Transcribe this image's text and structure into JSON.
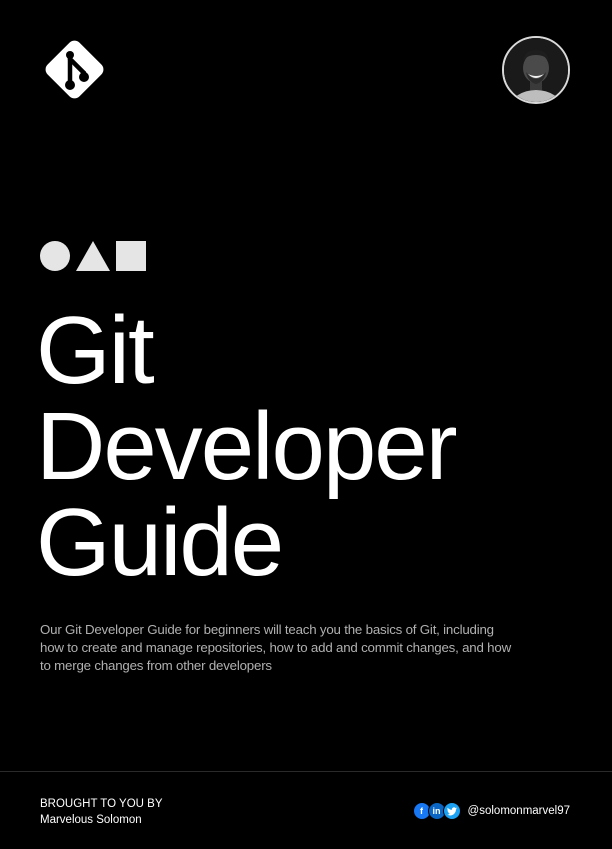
{
  "header": {
    "logo_icon": "git-branch-diamond-icon",
    "avatar_icon": "author-photo"
  },
  "decor": {
    "shapes": [
      "circle",
      "triangle",
      "square"
    ],
    "color": "#e5e5e5"
  },
  "title": {
    "line1": "Git",
    "line2": "Developer",
    "line3": "Guide"
  },
  "description": "Our Git Developer Guide for beginners will teach you the basics of Git, including how to create and manage repositories, how to add and commit changes, and how to merge changes from other developers",
  "footer": {
    "brought_by": "BROUGHT TO YOU BY",
    "author": "Marvelous Solomon",
    "social_icons": [
      "facebook-icon",
      "linkedin-icon",
      "twitter-icon"
    ],
    "handle": "@solomonmarvel97"
  },
  "colors": {
    "background": "#000000",
    "text": "#ffffff",
    "muted": "#b0b0b0"
  }
}
